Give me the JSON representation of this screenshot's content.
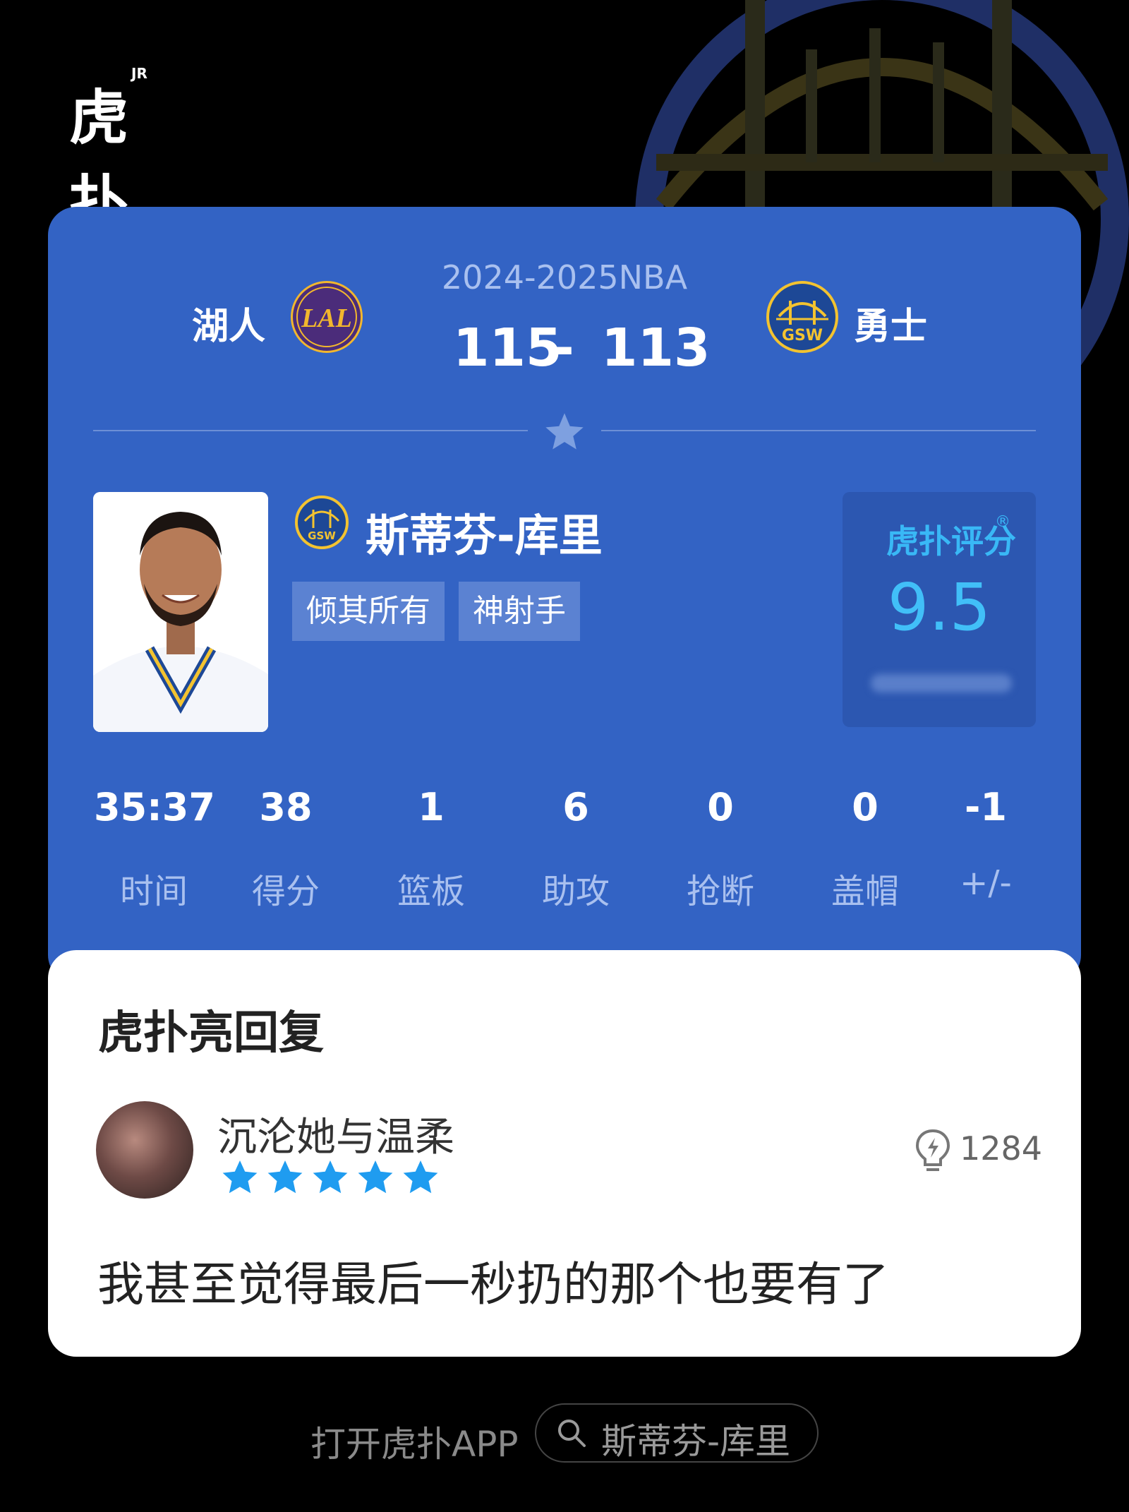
{
  "brand": {
    "name": "虎扑",
    "badge": "JR"
  },
  "game": {
    "season": "2024-2025NBA",
    "home_team": "湖人",
    "home_logo_text": "LAL",
    "away_team": "勇士",
    "away_logo_text": "GSW",
    "home_score": "115",
    "dash": "-",
    "away_score": "113"
  },
  "player": {
    "name": "斯蒂芬-库里",
    "team_logo_text": "GSW",
    "tags": [
      "倾其所有",
      "神射手"
    ],
    "rating_title": "虎扑评分",
    "rating_mark": "®",
    "rating": "9.5"
  },
  "stats": [
    {
      "value": "35:37",
      "label": "时间"
    },
    {
      "value": "38",
      "label": "得分"
    },
    {
      "value": "1",
      "label": "篮板"
    },
    {
      "value": "6",
      "label": "助攻"
    },
    {
      "value": "0",
      "label": "抢断"
    },
    {
      "value": "0",
      "label": "盖帽"
    },
    {
      "value": "-1",
      "label": "+/-"
    }
  ],
  "reply": {
    "section_title": "虎扑亮回复",
    "username": "沉沦她与温柔",
    "star_rating": 5,
    "likes": "1284",
    "text": "我甚至觉得最后一秒扔的那个也要有了"
  },
  "footer": {
    "open_app": "打开虎扑APP",
    "search_text": "斯蒂芬-库里"
  },
  "colors": {
    "card_blue": "#3363c4",
    "rating_cyan": "#41bff8",
    "star_blue": "#1f9cf0",
    "gsw_gold": "#f3c330",
    "lal_purple": "#4b2c7a"
  },
  "icons": [
    "warriors-bridge-logo",
    "lakers-logo",
    "star-icon",
    "lightbulb-icon",
    "search-icon"
  ]
}
